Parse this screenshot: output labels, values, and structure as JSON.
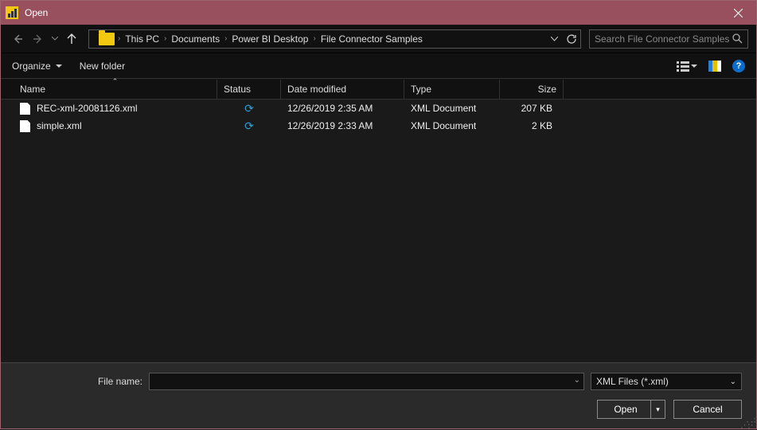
{
  "title": "Open",
  "breadcrumb": [
    "This PC",
    "Documents",
    "Power BI Desktop",
    "File Connector Samples"
  ],
  "search_placeholder": "Search File Connector Samples",
  "toolbar": {
    "organize": "Organize",
    "newfolder": "New folder"
  },
  "columns": {
    "name": "Name",
    "status": "Status",
    "date": "Date modified",
    "type": "Type",
    "size": "Size"
  },
  "files": [
    {
      "name": "REC-xml-20081126.xml",
      "date": "12/26/2019 2:35 AM",
      "type": "XML Document",
      "size": "207 KB"
    },
    {
      "name": "simple.xml",
      "date": "12/26/2019 2:33 AM",
      "type": "XML Document",
      "size": "2 KB"
    }
  ],
  "filename_label": "File name:",
  "filter": "XML Files (*.xml)",
  "buttons": {
    "open": "Open",
    "cancel": "Cancel"
  },
  "help_glyph": "?"
}
